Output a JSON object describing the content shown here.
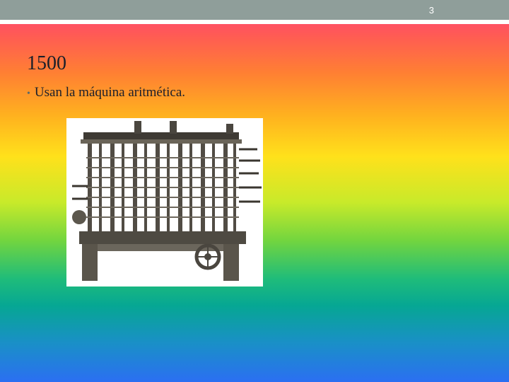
{
  "header": {
    "slide_number": "3"
  },
  "content": {
    "title": "1500",
    "bullets": [
      "Usan la máquina aritmética."
    ]
  },
  "image": {
    "icon": "arithmetic-machine-photo"
  }
}
